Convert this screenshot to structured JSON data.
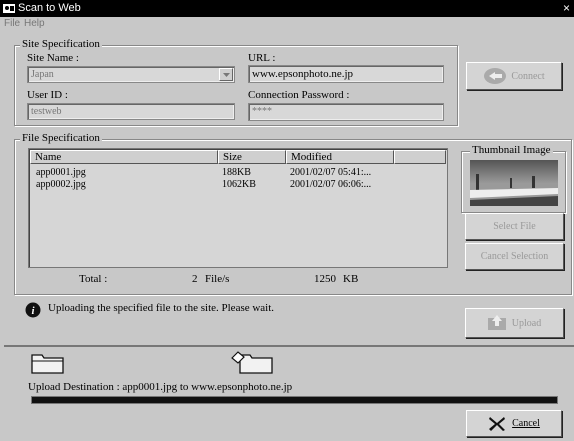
{
  "window": {
    "title": "Scan to Web",
    "close_glyph": "×"
  },
  "menu": {
    "items": [
      "File",
      "Help"
    ]
  },
  "site_spec": {
    "legend": "Site Specification",
    "site_name_label": "Site Name :",
    "site_name_value": "Japan",
    "url_label": "URL :",
    "url_value": "www.epsonphoto.ne.jp",
    "user_id_label": "User ID :",
    "user_id_value": "testweb",
    "password_label": "Connection Password :",
    "password_value": "****",
    "connect_label": "Connect"
  },
  "file_spec": {
    "legend": "File Specification",
    "columns": [
      "Name",
      "Size",
      "Modified"
    ],
    "rows": [
      {
        "name": "app0001.jpg",
        "size": "188KB",
        "modified": "2001/02/07 05:41:..."
      },
      {
        "name": "app0002.jpg",
        "size": "1062KB",
        "modified": "2001/02/07 06:06:..."
      }
    ],
    "total_label": "Total :",
    "total_count": "2",
    "total_unit": "File/s",
    "total_size": "1250",
    "total_size_unit": "KB",
    "thumbnail_legend": "Thumbnail Image",
    "select_file_label": "Select File",
    "cancel_selection_label": "Cancel Selection"
  },
  "status": {
    "info_text": "Uploading the specified file to the site. Please wait.",
    "upload_label": "Upload"
  },
  "upload_panel": {
    "destination_text": "Upload Destination : app0001.jpg to www.epsonphoto.ne.jp",
    "progress_fraction": 1.0,
    "cancel_label": "Cancel"
  },
  "colors": {
    "accent": "#000000",
    "disabled_text": "#999999"
  }
}
